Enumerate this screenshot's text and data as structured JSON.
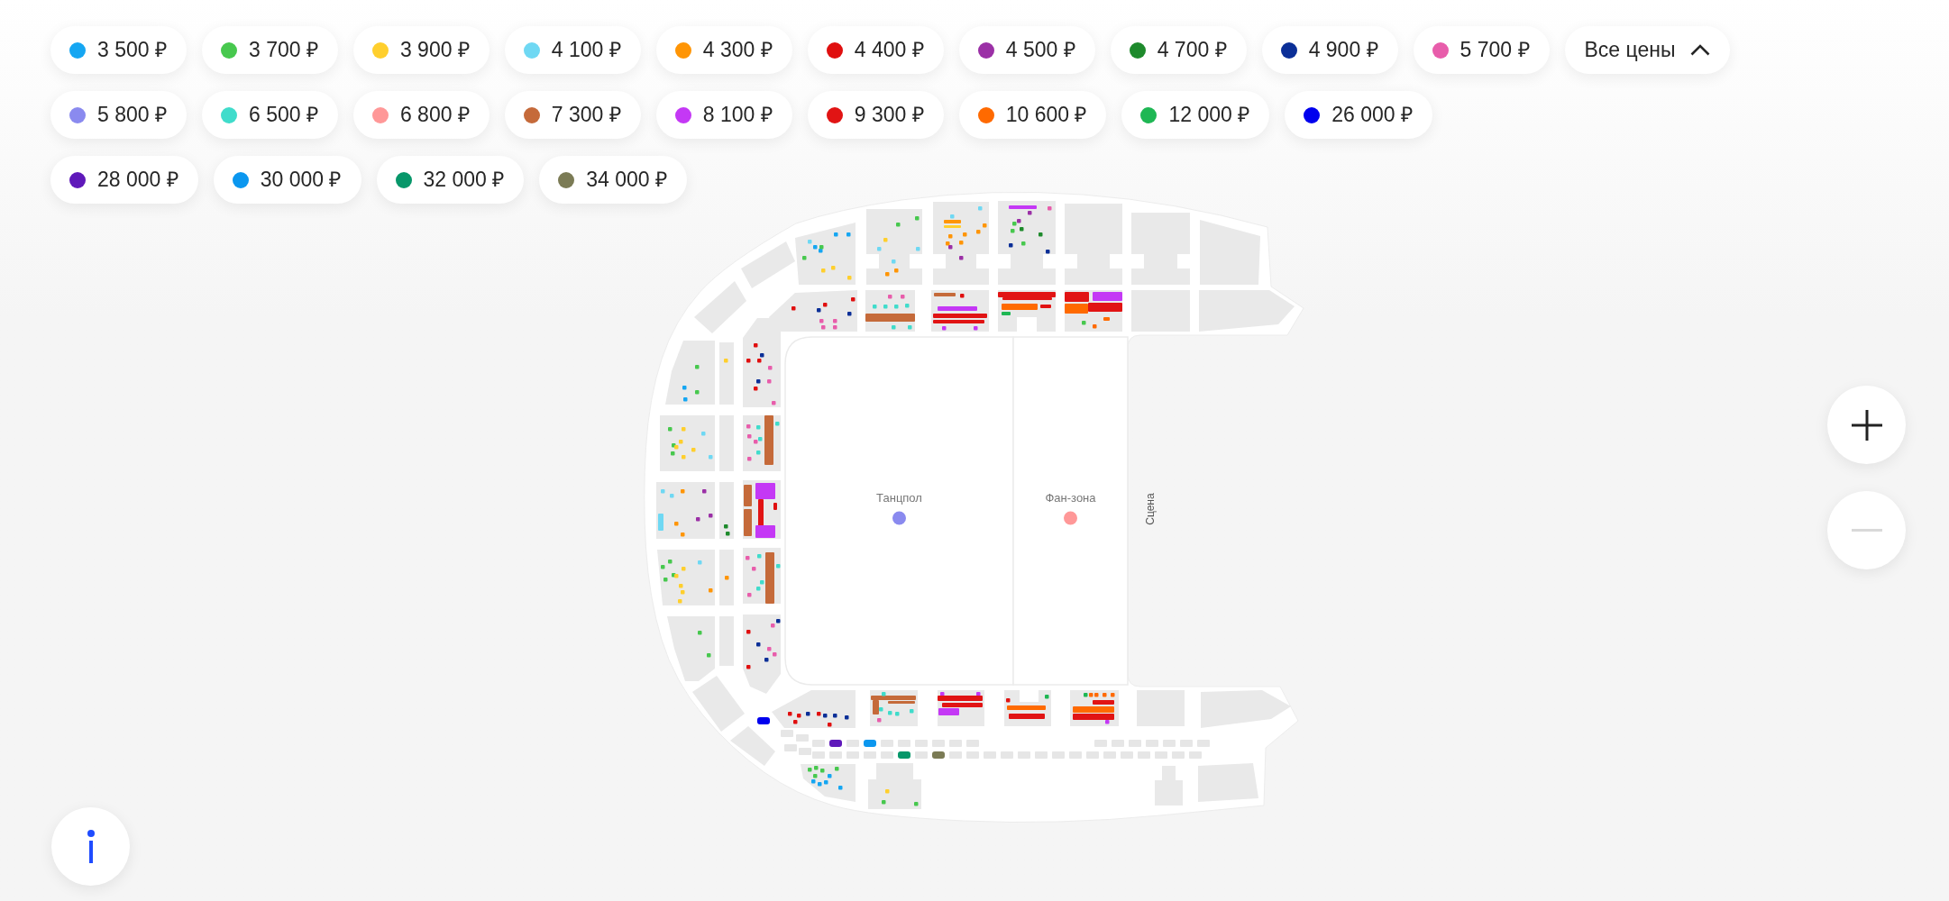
{
  "price_filter": {
    "rows": [
      {
        "chips": [
          {
            "label": "3 500 ₽",
            "color": "#15a6f2"
          },
          {
            "label": "3 700 ₽",
            "color": "#47c84e"
          },
          {
            "label": "3 900 ₽",
            "color": "#ffcf2d"
          },
          {
            "label": "4 100 ₽",
            "color": "#6fd8f3"
          },
          {
            "label": "4 300 ₽",
            "color": "#ff9505"
          },
          {
            "label": "4 400 ₽",
            "color": "#e00f0f"
          },
          {
            "label": "4 500 ₽",
            "color": "#9b30a6"
          },
          {
            "label": "4 700 ₽",
            "color": "#1e8a2c"
          },
          {
            "label": "4 900 ₽",
            "color": "#0b2f97"
          },
          {
            "label": "5 700 ₽",
            "color": "#e85dab"
          }
        ]
      },
      {
        "chips": [
          {
            "label": "5 800 ₽",
            "color": "#8a8aef"
          },
          {
            "label": "6 500 ₽",
            "color": "#40dccb"
          },
          {
            "label": "6 800 ₽",
            "color": "#ff9898"
          },
          {
            "label": "7 300 ₽",
            "color": "#c56a3a"
          },
          {
            "label": "8 100 ₽",
            "color": "#c438f5"
          },
          {
            "label": "9 300 ₽",
            "color": "#e11414"
          },
          {
            "label": "10 600 ₽",
            "color": "#ff6a00"
          },
          {
            "label": "12 000 ₽",
            "color": "#1fb754"
          },
          {
            "label": "26 000 ₽",
            "color": "#0000ee"
          }
        ]
      },
      {
        "chips": [
          {
            "label": "28 000 ₽",
            "color": "#5f19ba"
          },
          {
            "label": "30 000 ₽",
            "color": "#0b97ef"
          },
          {
            "label": "32 000 ₽",
            "color": "#07976a"
          },
          {
            "label": "34 000 ₽",
            "color": "#7b7b55"
          }
        ]
      }
    ],
    "all_prices_button": {
      "label": "Все цены",
      "expanded": true
    }
  },
  "map": {
    "zones": [
      {
        "label": "Танцпол",
        "color": "#8a8aef"
      },
      {
        "label": "Фан-зона",
        "color": "#ff9898"
      }
    ],
    "stage_label": "Сцена"
  },
  "zoom_controls": [
    {
      "kind": "zoom_in",
      "disabled": false
    },
    {
      "kind": "zoom_out",
      "disabled": true
    }
  ]
}
